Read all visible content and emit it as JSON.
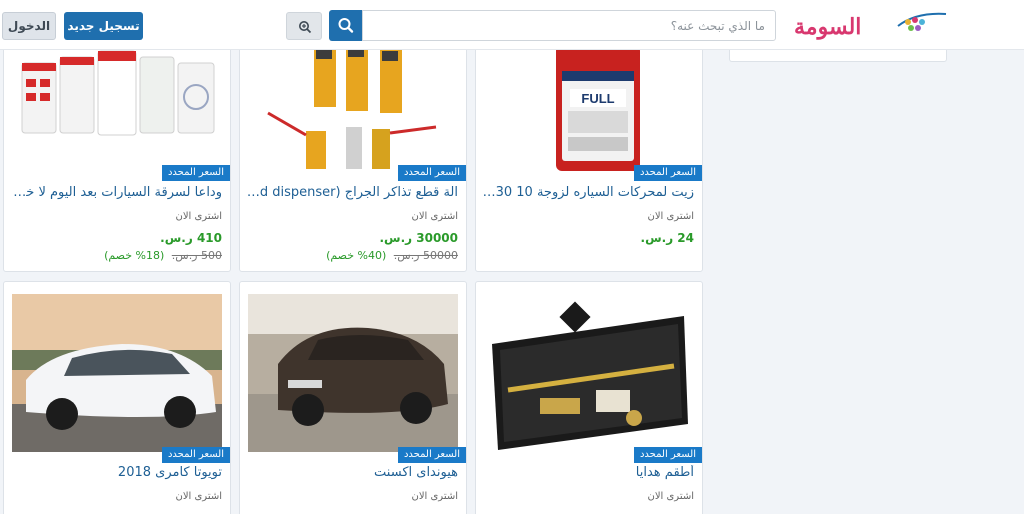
{
  "header": {
    "login_label": "الدخول",
    "register_label": "تسجيل جديد",
    "search_placeholder": "ما الذي تبحث عنه؟",
    "logo_text": "السومة",
    "accent_color": "#1f6fae",
    "logo_color": "#d8386f",
    "icons": [
      "zoom-in-icon",
      "search-icon"
    ]
  },
  "products": [
    {
      "badge": "السعر المحدد",
      "title": "زيت لمحركات السياره لزوجة 10 5w30...",
      "buy": "اشترى الان",
      "price": "24 ر.س.",
      "image": "motor-oil-bottle"
    },
    {
      "badge": "السعر المحدد",
      "title": "الة قطع تذاكر الجراج (card dispenser) ...",
      "buy": "اشترى الان",
      "price": "30000 ر.س.",
      "old_price": "50000 ر.س.",
      "discount": "(40% خصم)",
      "image": "parking-barrier-machines"
    },
    {
      "badge": "السعر المحدد",
      "title": "وداعا لسرقة السيارات بعد اليوم لا خو...",
      "buy": "اشترى الان",
      "price": "410 ر.س.",
      "old_price": "500 ر.س.",
      "discount": "(18% خصم)",
      "image": "car-tracking-app-screens"
    },
    {
      "badge": "السعر المحدد",
      "title": "أطقم هدايا",
      "buy": "اشترى الان",
      "image": "gift-set-case"
    },
    {
      "badge": "السعر المحدد",
      "title": "هيونداى اكسنت",
      "buy": "اشترى الان",
      "image": "hyundai-accent-car"
    },
    {
      "badge": "السعر المحدد",
      "title": "تويوتا كامرى 2018",
      "buy": "اشترى الان",
      "image": "toyota-camry-car"
    }
  ]
}
